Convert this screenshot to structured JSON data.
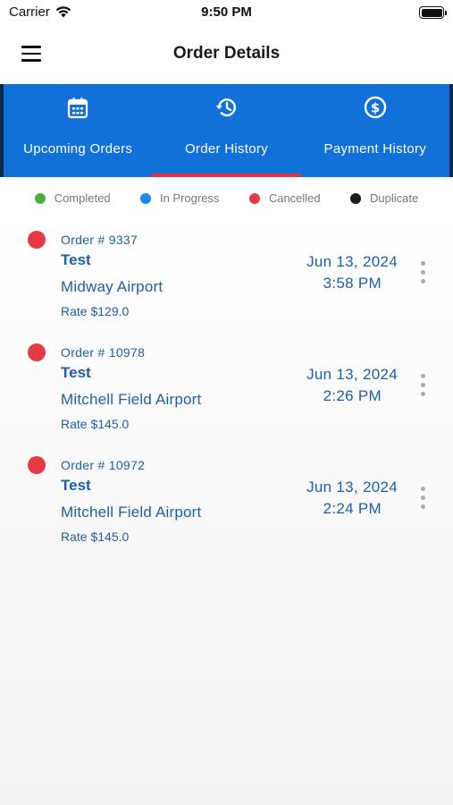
{
  "status_bar": {
    "carrier": "Carrier",
    "time": "9:50 PM"
  },
  "header": {
    "title": "Order Details",
    "menu_icon": "hamburger-icon"
  },
  "tabs": [
    {
      "label": "Upcoming Orders",
      "icon": "calendar-icon",
      "active": false
    },
    {
      "label": "Order History",
      "icon": "history-icon",
      "active": true
    },
    {
      "label": "Payment History",
      "icon": "dollar-circle-icon",
      "active": false
    }
  ],
  "colors": {
    "tab_bar": "#1271d9",
    "active_indicator": "#e0363e",
    "text_blue": "#1c5fa8"
  },
  "legend": [
    {
      "label": "Completed",
      "color": "#4caf3a"
    },
    {
      "label": "In Progress",
      "color": "#1e88e5"
    },
    {
      "label": "Cancelled",
      "color": "#e53945"
    },
    {
      "label": "Duplicate",
      "color": "#1a1a1a"
    }
  ],
  "orders": [
    {
      "order_no": "Order # 9337",
      "name": "Test",
      "location": "Midway Airport",
      "rate": "Rate $129.0",
      "date": "Jun 13, 2024",
      "time": "3:58 PM",
      "status_color": "#e53945"
    },
    {
      "order_no": "Order # 10978",
      "name": "Test",
      "location": "Mitchell Field Airport",
      "rate": "Rate $145.0",
      "date": "Jun 13, 2024",
      "time": "2:26 PM",
      "status_color": "#e53945"
    },
    {
      "order_no": "Order # 10972",
      "name": "Test",
      "location": "Mitchell Field Airport",
      "rate": "Rate $145.0",
      "date": "Jun 13, 2024",
      "time": "2:24 PM",
      "status_color": "#e53945"
    }
  ]
}
